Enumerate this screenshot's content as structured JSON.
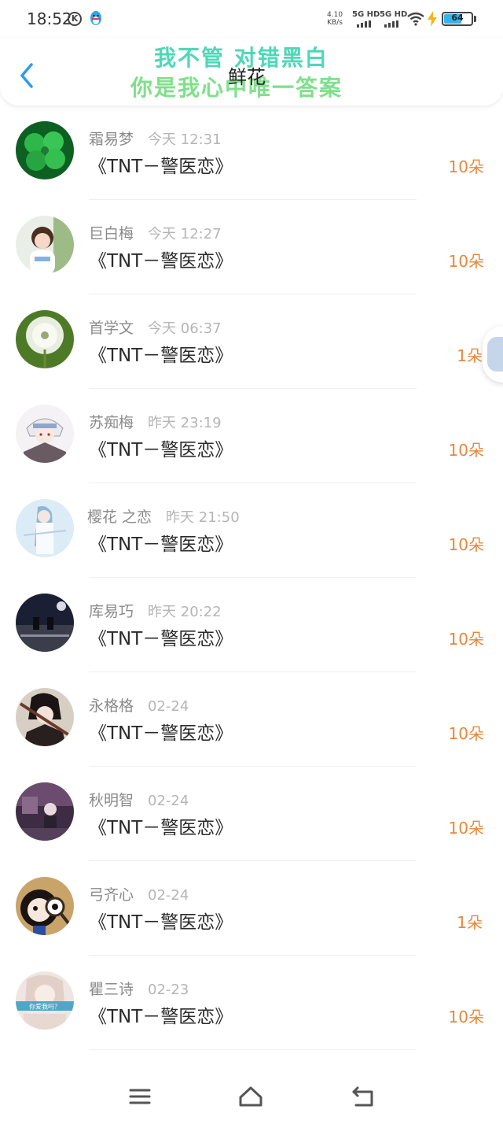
{
  "status_bar": {
    "time": "18:52",
    "k_badge": "K",
    "speed_value": "4.10",
    "speed_unit": "KB/s",
    "network1": "5G HD",
    "network2": "5G HD",
    "battery": "64",
    "battery_level_percent": 64
  },
  "header": {
    "overlay_line1": "我不管 对错黑白",
    "overlay_line2": "你是我心中唯一答案",
    "title": "鲜花"
  },
  "items": [
    {
      "name": "霜易梦",
      "time": "今天 12:31",
      "song": "《TNT－警医恋》",
      "count": "10朵"
    },
    {
      "name": "巨白梅",
      "time": "今天 12:27",
      "song": "《TNT－警医恋》",
      "count": "10朵"
    },
    {
      "name": "首学文",
      "time": "今天 06:37",
      "song": "《TNT－警医恋》",
      "count": "1朵"
    },
    {
      "name": "苏痴梅",
      "time": "昨天 23:19",
      "song": "《TNT－警医恋》",
      "count": "10朵"
    },
    {
      "name": "樱花 之恋",
      "time": "昨天 21:50",
      "song": "《TNT－警医恋》",
      "count": "10朵"
    },
    {
      "name": "库易巧",
      "time": "昨天 20:22",
      "song": "《TNT－警医恋》",
      "count": "10朵"
    },
    {
      "name": "永格格",
      "time": "02-24",
      "song": "《TNT－警医恋》",
      "count": "10朵"
    },
    {
      "name": "秋明智",
      "time": "02-24",
      "song": "《TNT－警医恋》",
      "count": "10朵"
    },
    {
      "name": "弓齐心",
      "time": "02-24",
      "song": "《TNT－警医恋》",
      "count": "1朵"
    },
    {
      "name": "瞿三诗",
      "time": "02-23",
      "song": "《TNT－警医恋》",
      "count": "10朵"
    }
  ],
  "avatar_tags": {
    "item_9": "你爱我吗？"
  },
  "colors": {
    "accent_blue": "#2a9ee8",
    "count_orange": "#e8873a",
    "overlay_green": "#6bdc98",
    "battery_blue": "#32b4f0"
  },
  "icons": {
    "back": "chevron-left-icon",
    "menu": "menu-icon",
    "home": "home-icon",
    "return": "return-icon",
    "wifi": "wifi-icon",
    "charging": "bolt-icon"
  }
}
